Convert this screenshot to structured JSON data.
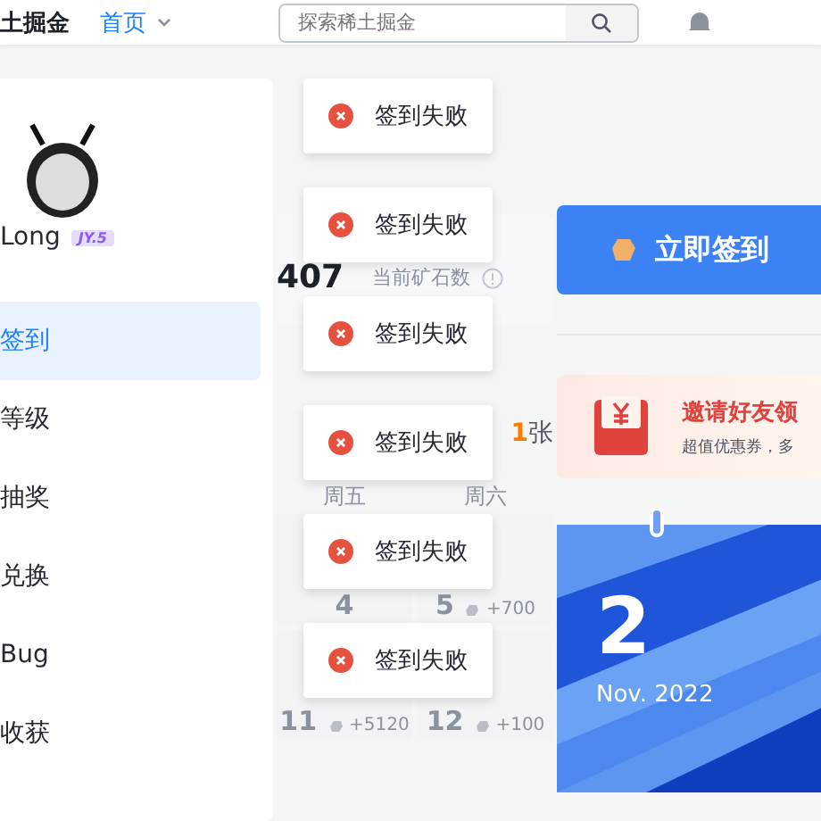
{
  "header": {
    "logo": "土掘金",
    "nav": {
      "label": "首页",
      "selected": true
    },
    "search": {
      "placeholder": "探索稀土掘金"
    }
  },
  "profile": {
    "name": "Long",
    "level": "JY.5"
  },
  "sidebar": {
    "items": [
      {
        "label": "签到",
        "selected": true
      },
      {
        "label": "等级",
        "selected": false
      },
      {
        "label": "抽奖",
        "selected": false
      },
      {
        "label": "兑换",
        "selected": false
      },
      {
        "label": "Bug",
        "selected": false
      },
      {
        "label": "收获",
        "selected": false
      }
    ]
  },
  "stats": {
    "ore": "407",
    "ore_label": "当前矿石数"
  },
  "cards": {
    "count": "1",
    "unit": "张"
  },
  "calendar": {
    "weekdays": [
      "周五",
      "周六"
    ],
    "days": [
      {
        "day": "4"
      },
      {
        "day": "5",
        "reward": "+700"
      },
      {
        "day": "11",
        "reward": "+5120"
      },
      {
        "day": "12",
        "reward": "+100"
      }
    ]
  },
  "signin_button": "立即签到",
  "invite": {
    "title": "邀请好友领",
    "subtitle": "超值优惠券，多"
  },
  "date_card": {
    "day": "2",
    "month": "Nov. 2022"
  },
  "toasts": [
    {
      "kind": "error",
      "text": "签到失败"
    },
    {
      "kind": "error",
      "text": "签到失败"
    },
    {
      "kind": "error",
      "text": "签到失败"
    },
    {
      "kind": "error",
      "text": "签到失败"
    },
    {
      "kind": "error",
      "text": "签到失败"
    },
    {
      "kind": "error",
      "text": "签到失败"
    }
  ]
}
